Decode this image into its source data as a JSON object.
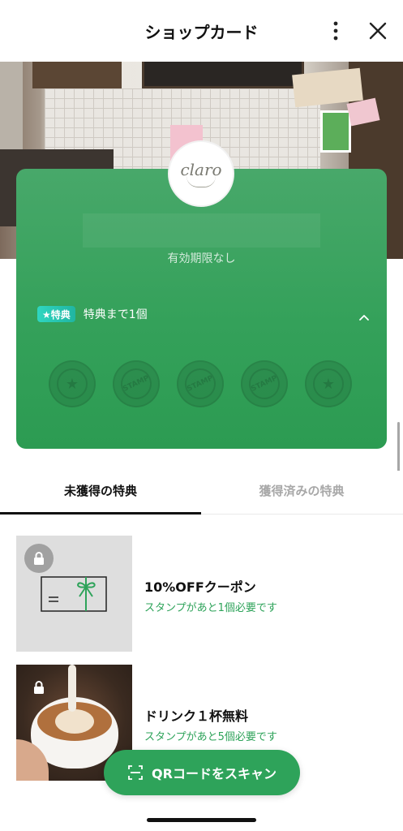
{
  "header": {
    "title": "ショップカード",
    "more_icon": "more-vertical-icon",
    "close_icon": "close-icon"
  },
  "card": {
    "logo_text": "claro",
    "shop_name": "",
    "expiry": "有効期限なし",
    "reward_badge": "★特典",
    "reward_progress": "特典まで1個",
    "stamps": [
      {
        "label": "★",
        "filled": false
      },
      {
        "label": "STAMP",
        "filled": false
      },
      {
        "label": "STAMP",
        "filled": false
      },
      {
        "label": "STAMP",
        "filled": false
      },
      {
        "label": "★",
        "filled": false
      }
    ],
    "colors": {
      "card_green": "#34a15a",
      "badge_teal": "#20b5a2"
    }
  },
  "tabs": [
    {
      "label": "未獲得の特典",
      "active": true
    },
    {
      "label": "獲得済みの特典",
      "active": false
    }
  ],
  "rewards": [
    {
      "title": "10%OFFクーポン",
      "subtitle": "スタンプがあと1個必要です",
      "icon": "gift-card-icon",
      "locked": true
    },
    {
      "title": "ドリンク１杯無料",
      "subtitle": "スタンプがあと5個必要です",
      "icon": "coffee-photo",
      "locked": true
    }
  ],
  "scan_button": {
    "label": "QRコードをスキャン",
    "icon": "qr-scan-icon"
  },
  "accent_color": "#2ea35a"
}
